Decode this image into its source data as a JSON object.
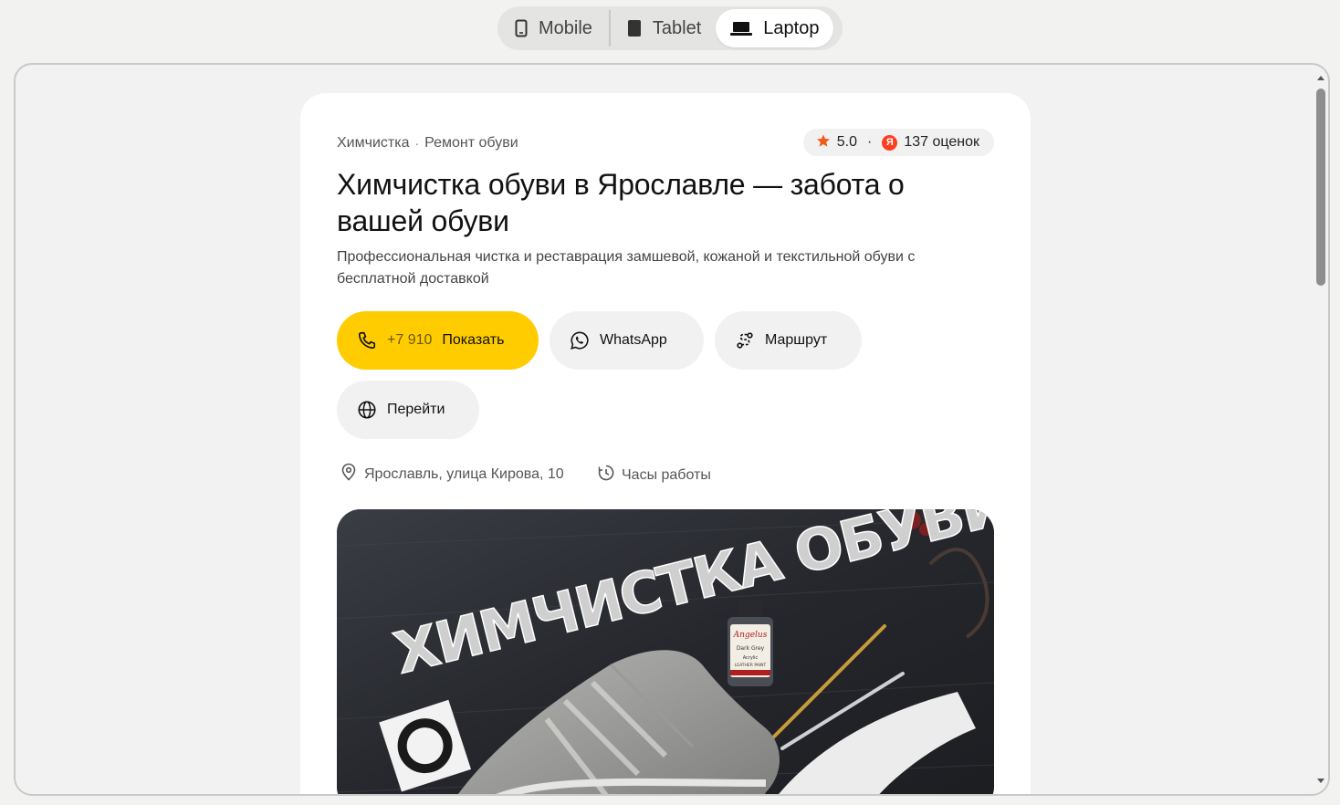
{
  "device_switcher": {
    "mobile": "Mobile",
    "tablet": "Tablet",
    "laptop": "Laptop",
    "active": "laptop"
  },
  "card": {
    "categories": [
      "Химчистка",
      "Ремонт обуви"
    ],
    "category_separator": "·",
    "rating": {
      "score": "5.0",
      "separator": "·",
      "yandex_letter": "Я",
      "reviews": "137 оценок",
      "star_color": "#f05a1a"
    },
    "title": "Химчистка обуви в Ярославле — забота о вашей обуви",
    "subtitle": "Профессиональная чистка и реставрация замшевой, кожаной и текстильной обуви с бесплатной доставкой",
    "buttons": {
      "phone_prefix": "+7 910",
      "phone_action": "Показать",
      "whatsapp": "WhatsApp",
      "route": "Маршрут",
      "website": "Перейти"
    },
    "address": "Ярославль, улица Кирова, 10",
    "hours": "Часы работы",
    "photo": {
      "sign_text": "ХИМЧИСТКА ОБУВИ",
      "bottle_brand": "Angelus",
      "bottle_color": "Dark Grey",
      "bottle_type": "Acrylic",
      "bottle_product": "LEATHER PAINT"
    }
  },
  "colors": {
    "accent": "#ffcc00",
    "chip_bg": "#f1f1f1",
    "page_bg": "#f2f2f2",
    "yandex_red": "#fc3f1d"
  }
}
